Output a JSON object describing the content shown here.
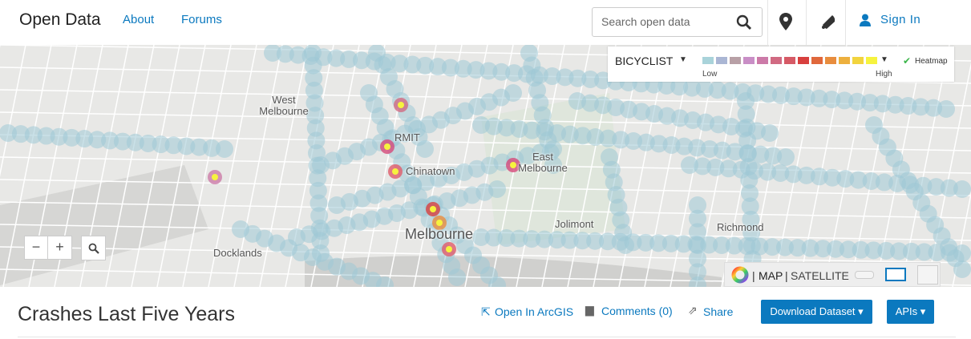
{
  "header": {
    "brand": "Open Data",
    "nav": [
      "About",
      "Forums"
    ],
    "search_placeholder": "Search open data",
    "sign_in": "Sign In"
  },
  "map": {
    "labels": [
      "West Melbourne",
      "RMIT",
      "Chinatown",
      "East Melbourne",
      "Melbourne",
      "Jolimont",
      "Richmond",
      "Docklands"
    ],
    "legend": {
      "field": "BICYCLIST",
      "low": "Low",
      "high": "High",
      "heatmap": "Heatmap",
      "colors": [
        "#a9d3da",
        "#aab6d4",
        "#b8a0a6",
        "#c98ec6",
        "#cc7aa8",
        "#d16a82",
        "#d65a66",
        "#d8403e",
        "#e0683c",
        "#e88d3e",
        "#edb03e",
        "#f2d43e",
        "#f6f33e"
      ]
    },
    "basemap": {
      "map": "MAP",
      "satellite": "SATELLITE"
    }
  },
  "dataset": {
    "title": "Crashes Last Five Years",
    "open_arcgis": "Open In ArcGIS",
    "comments": "Comments (0)",
    "share": "Share",
    "download": "Download Dataset",
    "apis": "APIs"
  }
}
